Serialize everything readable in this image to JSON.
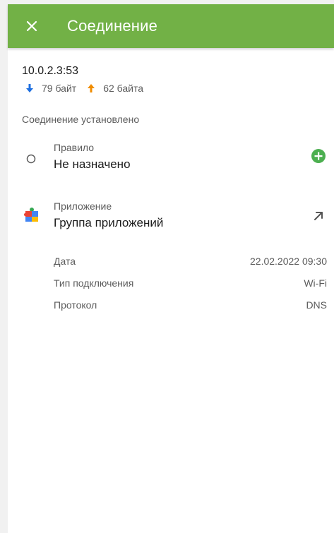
{
  "appbar": {
    "title": "Соединение",
    "close_icon": "close-icon",
    "color": "#72b146"
  },
  "connection": {
    "address": "10.0.2.3:53",
    "received": "79 байт",
    "sent": "62 байта",
    "received_color": "#1e6fe0",
    "sent_color": "#f08c00",
    "status": "Соединение установлено"
  },
  "rule": {
    "caption": "Правило",
    "value": "Не назначено",
    "add_icon": "add-circle-icon"
  },
  "app": {
    "caption": "Приложение",
    "value": "Группа приложений",
    "open_icon": "arrow-up-right-icon"
  },
  "details": [
    {
      "key": "Дата",
      "value": "22.02.2022 09:30"
    },
    {
      "key": "Тип подключения",
      "value": "Wi-Fi"
    },
    {
      "key": "Протокол",
      "value": "DNS"
    }
  ]
}
